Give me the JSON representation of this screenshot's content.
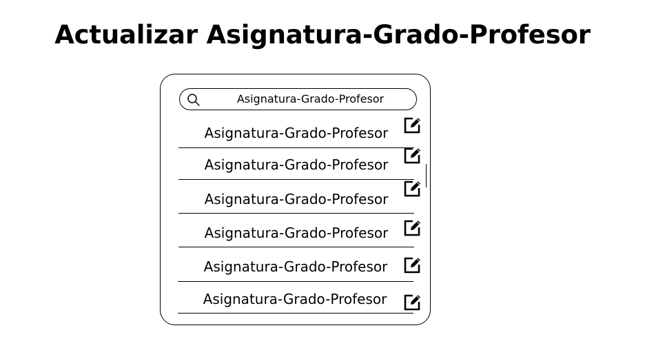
{
  "title": "Actualizar Asignatura-Grado-Profesor",
  "search": {
    "value": "Asignatura-Grado-Profesor"
  },
  "list": {
    "items": [
      {
        "label": "Asignatura-Grado-Profesor",
        "action_icon": "edit-icon"
      },
      {
        "label": "Asignatura-Grado-Profesor",
        "action_icon": "edit-icon"
      },
      {
        "label": "Asignatura-Grado-Profesor",
        "action_icon": "edit-icon"
      },
      {
        "label": "Asignatura-Grado-Profesor",
        "action_icon": "edit-icon"
      },
      {
        "label": "Asignatura-Grado-Profesor",
        "action_icon": "edit-icon"
      },
      {
        "label": "Asignatura-Grado-Profesor",
        "action_icon": "edit-icon"
      }
    ]
  }
}
